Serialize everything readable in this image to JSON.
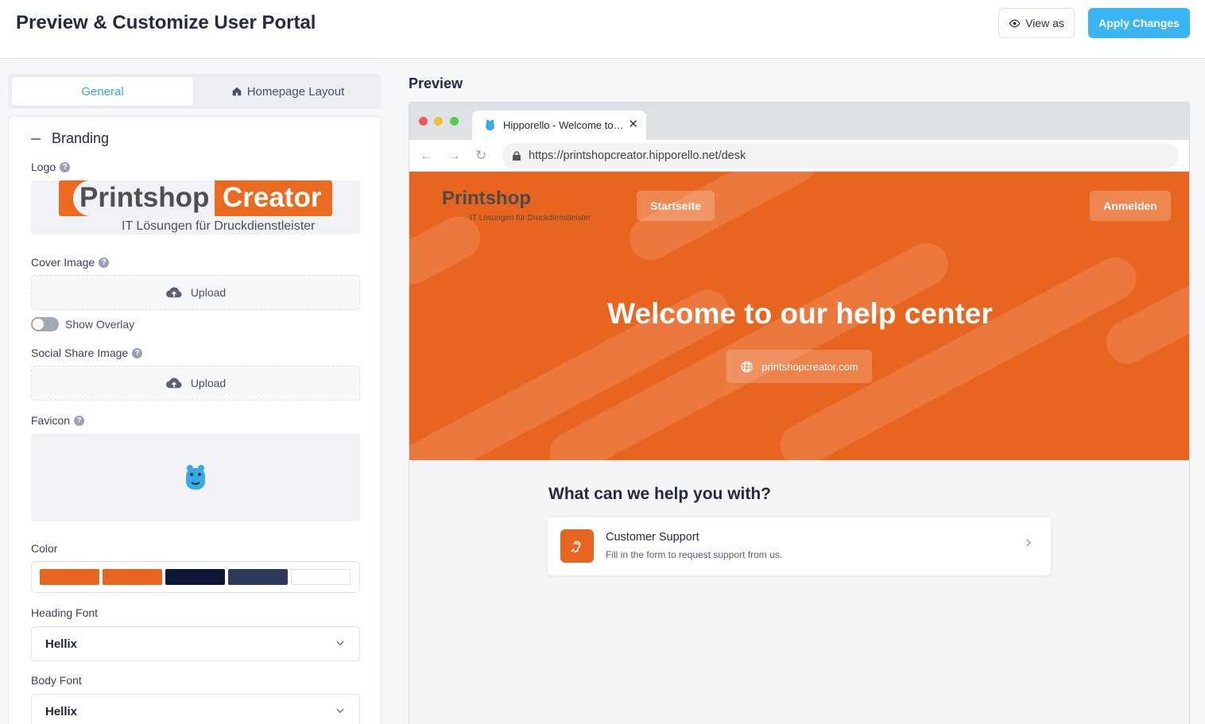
{
  "header": {
    "title": "Preview & Customize User Portal",
    "view_as_label": "View as",
    "apply_label": "Apply Changes"
  },
  "tabs": [
    {
      "label": "General",
      "active": true
    },
    {
      "label": "Homepage Layout",
      "active": false
    }
  ],
  "branding": {
    "section_title": "Branding",
    "logo_label": "Logo",
    "logo": {
      "part1": "Printshop",
      "part2": "Creator",
      "tagline": "IT Lösungen für Druckdienstleister"
    },
    "cover_label": "Cover Image",
    "cover_upload": "Upload",
    "overlay_label": "Show Overlay",
    "overlay_on": false,
    "social_label": "Social Share Image",
    "social_upload": "Upload",
    "favicon_label": "Favicon",
    "color_label": "Color",
    "colors": [
      "#e8651f",
      "#e8651f",
      "#0f1736",
      "#2e3a5c",
      "#ffffff"
    ],
    "heading_font_label": "Heading Font",
    "heading_font": "Hellix",
    "body_font_label": "Body Font",
    "body_font": "Hellix"
  },
  "preview": {
    "title": "Preview",
    "tab_title": "Hipporello - Welcome to…",
    "url": "https://printshopcreator.hipporello.net/desk",
    "hero": {
      "logo_text": "Printshop",
      "logo_sub": "IT Lösungen für Druckdienstleister",
      "nav_home": "Startseite",
      "nav_login": "Anmelden",
      "title": "Welcome to our help center",
      "link": "printshopcreator.com"
    },
    "help_heading": "What can we help you with?",
    "card": {
      "title": "Customer Support",
      "desc": "Fill in the form to request support from us."
    }
  }
}
